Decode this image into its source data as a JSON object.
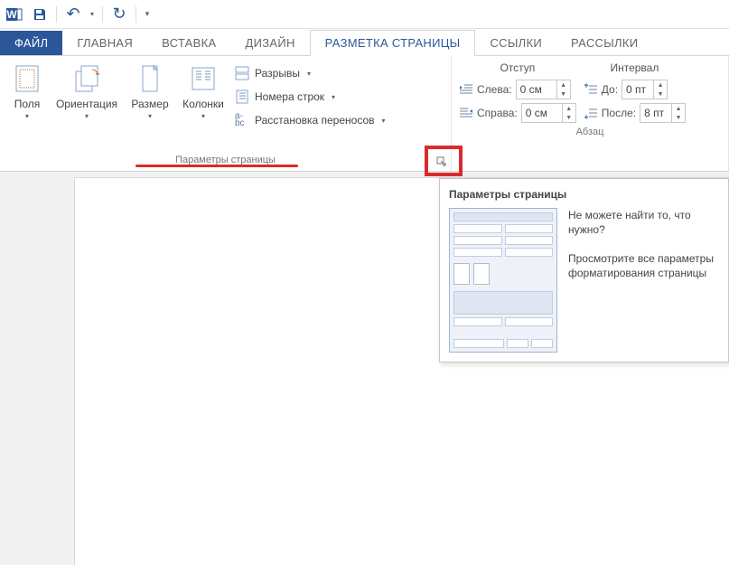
{
  "qat": {
    "undo": "↶",
    "redo": "↷"
  },
  "tabs": {
    "file": "ФАЙЛ",
    "home": "ГЛАВНАЯ",
    "insert": "ВСТАВКА",
    "design": "ДИЗАЙН",
    "layout": "РАЗМЕТКА СТРАНИЦЫ",
    "references": "ССЫЛКИ",
    "mailings": "РАССЫЛКИ"
  },
  "page_setup": {
    "group_label": "Параметры страницы",
    "margins": "Поля",
    "orientation": "Ориентация",
    "size": "Размер",
    "columns": "Колонки",
    "breaks": "Разрывы",
    "line_numbers": "Номера строк",
    "hyphenation": "Расстановка переносов"
  },
  "paragraph": {
    "group_label": "Абзац",
    "indent_head": "Отступ",
    "spacing_head": "Интервал",
    "left_label": "Слева:",
    "right_label": "Справа:",
    "before_label": "До:",
    "after_label": "После:",
    "left_val": "0 см",
    "right_val": "0 см",
    "before_val": "0 пт",
    "after_val": "8 пт"
  },
  "tooltip": {
    "title": "Параметры страницы",
    "line1": "Не можете найти то, что нужно?",
    "line2": "Просмотрите все параметры форматирования страницы"
  }
}
